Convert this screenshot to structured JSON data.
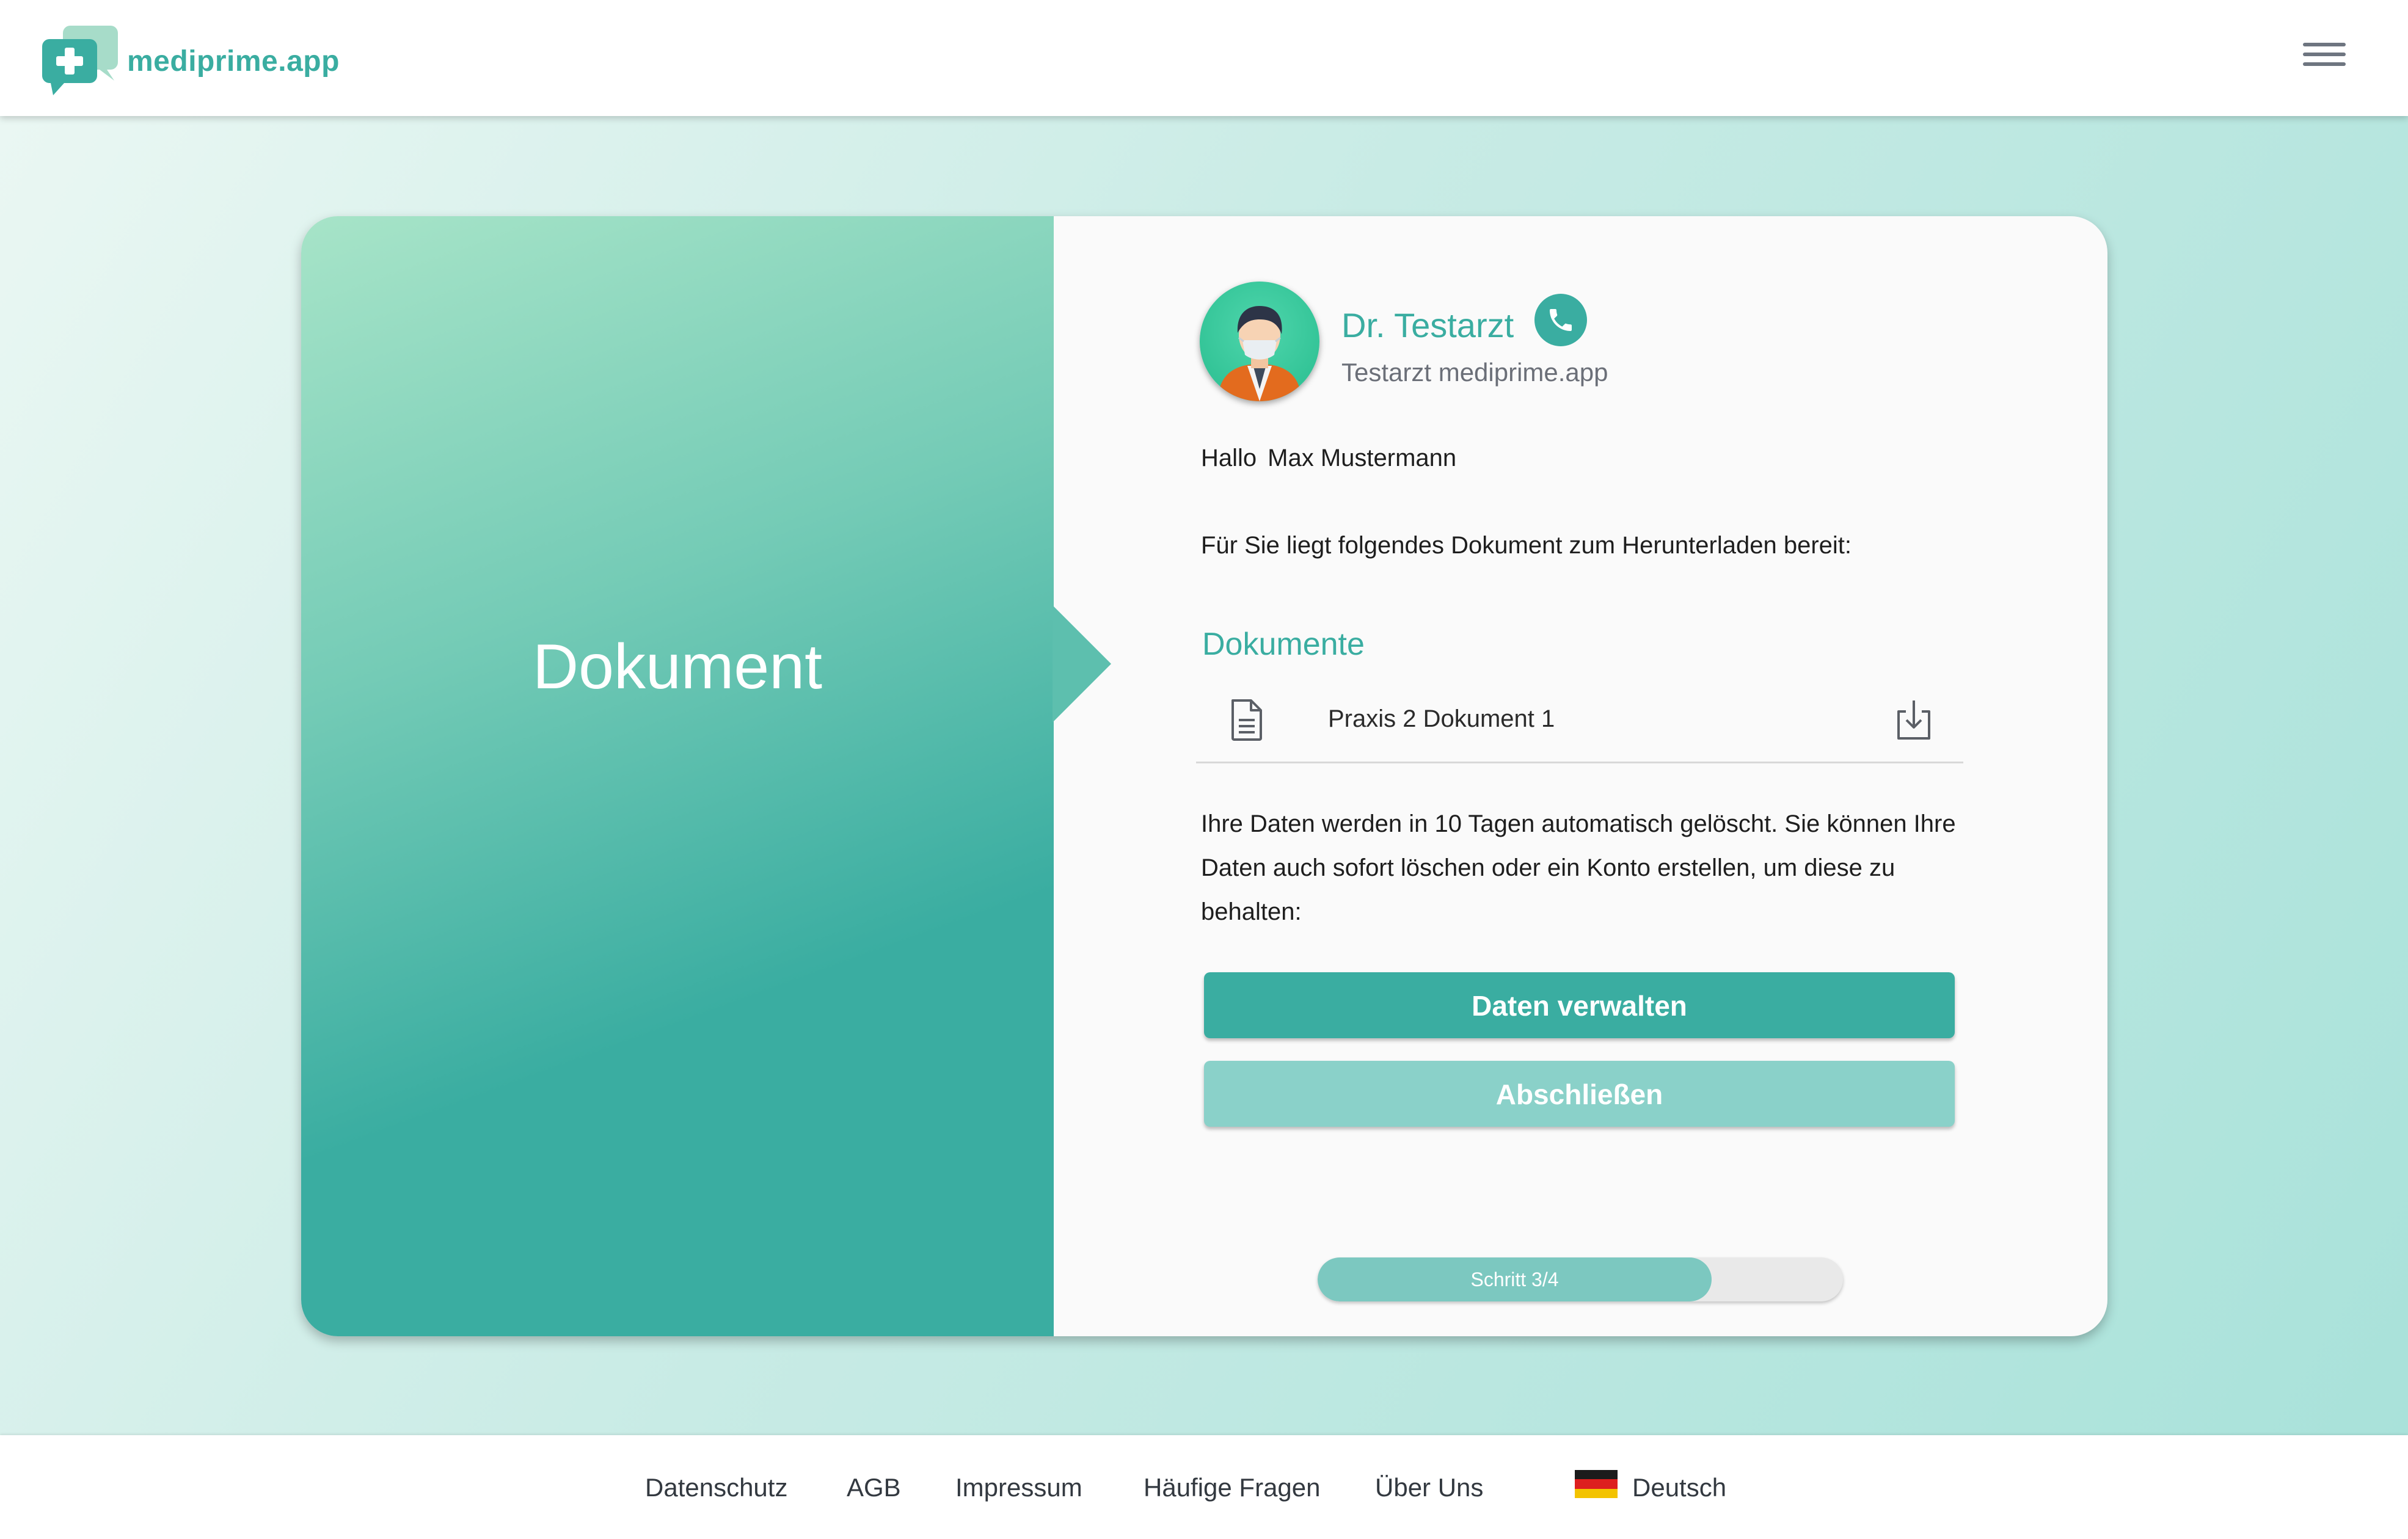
{
  "header": {
    "brand": "mediprime.app",
    "icons": {
      "logo": "medical-chat-logo",
      "menu": "hamburger-menu-icon"
    }
  },
  "card": {
    "left_title": "Dokument",
    "doctor": {
      "name": "Dr. Testarzt",
      "subtitle": "Testarzt mediprime.app",
      "avatar": "doctor-avatar",
      "phone_icon": "phone-icon"
    },
    "greeting": {
      "hello": "Hallo",
      "name": "Max Mustermann"
    },
    "intro": "Für Sie liegt folgendes Dokument zum Herunterladen bereit:",
    "documents": {
      "heading": "Dokumente",
      "items": [
        {
          "name": "Praxis 2 Dokument 1",
          "icon": "file-text-icon",
          "action_icon": "download-icon"
        }
      ]
    },
    "notice": "Ihre Daten werden in 10 Tagen automatisch gelöscht. Sie können Ihre Daten auch sofort löschen oder ein Konto erstellen, um diese zu behalten:",
    "buttons": {
      "manage": "Daten verwalten",
      "finish": "Abschließen"
    },
    "progress": {
      "label": "Schritt 3/4",
      "value": 0.75
    }
  },
  "footer": {
    "links": [
      "Datenschutz",
      "AGB",
      "Impressum",
      "Häufige Fragen",
      "Über Uns"
    ],
    "language": "Deutsch",
    "language_icon": "german-flag-icon"
  },
  "colors": {
    "accent": "#3aada1",
    "accent_light": "#8ad1c9",
    "progress_fill": "#7cc8c0"
  }
}
